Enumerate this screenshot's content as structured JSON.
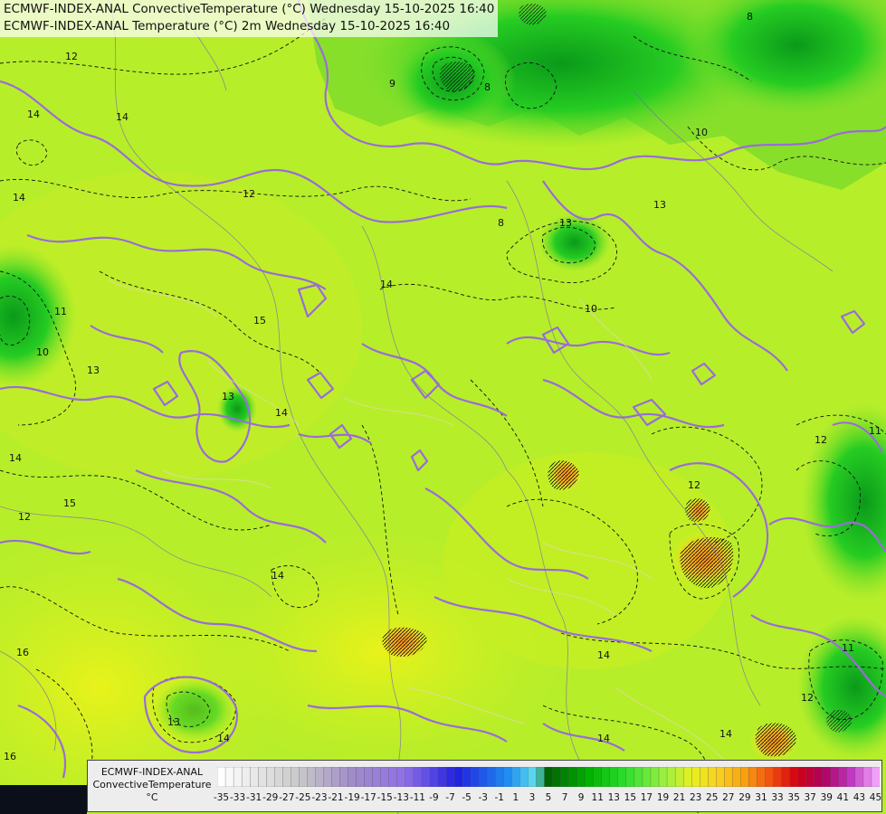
{
  "titles": {
    "line1": "ECMWF-INDEX-ANAL ConvectiveTemperature (°C) Wednesday 15-10-2025 16:40",
    "line2": "ECMWF-INDEX-ANAL Temperature (°C) 2m Wednesday 15-10-2025 16:40"
  },
  "legend": {
    "line1": "ECMWF-INDEX-ANAL",
    "line2": "ConvectiveTemperature",
    "unit": "°C",
    "labels": [
      "-35",
      "-33",
      "-31",
      "-29",
      "-27",
      "-25",
      "-23",
      "-21",
      "-19",
      "-17",
      "-15",
      "-13",
      "-11",
      "-9",
      "-7",
      "-5",
      "-3",
      "-1",
      "1",
      "3",
      "5",
      "7",
      "9",
      "11",
      "13",
      "15",
      "17",
      "19",
      "21",
      "23",
      "25",
      "27",
      "29",
      "31",
      "33",
      "35",
      "37",
      "39",
      "41",
      "43",
      "45"
    ]
  },
  "contour_labels": [
    "12",
    "14",
    "14",
    "14",
    "11",
    "10",
    "13",
    "15",
    "12",
    "14",
    "13",
    "14",
    "14",
    "16",
    "15",
    "16",
    "13",
    "14",
    "12",
    "14",
    "12",
    "14",
    "14",
    "11",
    "11",
    "12",
    "13",
    "10",
    "10",
    "8",
    "8",
    "8",
    "9",
    "13",
    "12",
    "14"
  ],
  "colors": {
    "base_fill": "#b7ee2a",
    "cold_green": "#22cc22",
    "warm_yellow": "#e0f020",
    "isotherm_line": "#9a6cd8",
    "dashed_contour": "#111111"
  }
}
